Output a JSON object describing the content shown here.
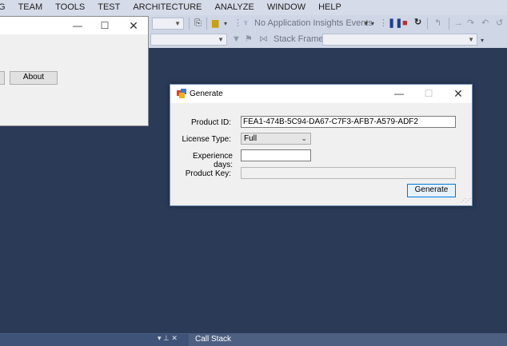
{
  "menubar": {
    "items": [
      "G",
      "TEAM",
      "TOOLS",
      "TEST",
      "ARCHITECTURE",
      "ANALYZE",
      "WINDOW",
      "HELP"
    ]
  },
  "toolbar": {
    "insights_label": "No Application Insights Events",
    "stack_frame_label": "Stack Frame:"
  },
  "bg_window": {
    "about_label": "About"
  },
  "dialog": {
    "title": "Generate",
    "product_id_label": "Product ID:",
    "product_id_value": "FEA1-474B-5C94-DA67-C7F3-AFB7-A579-ADF2",
    "license_type_label": "License Type:",
    "license_type_value": "Full",
    "experience_days_label": "Experience days:",
    "experience_days_value": "",
    "product_key_label": "Product Key:",
    "product_key_value": "",
    "generate_label": "Generate"
  },
  "bottom": {
    "call_stack_label": "Call Stack"
  },
  "colors": {
    "ide_background": "#2b3a57",
    "menubar": "#d6dbe9",
    "dialog_border": "#6e8fb8"
  }
}
